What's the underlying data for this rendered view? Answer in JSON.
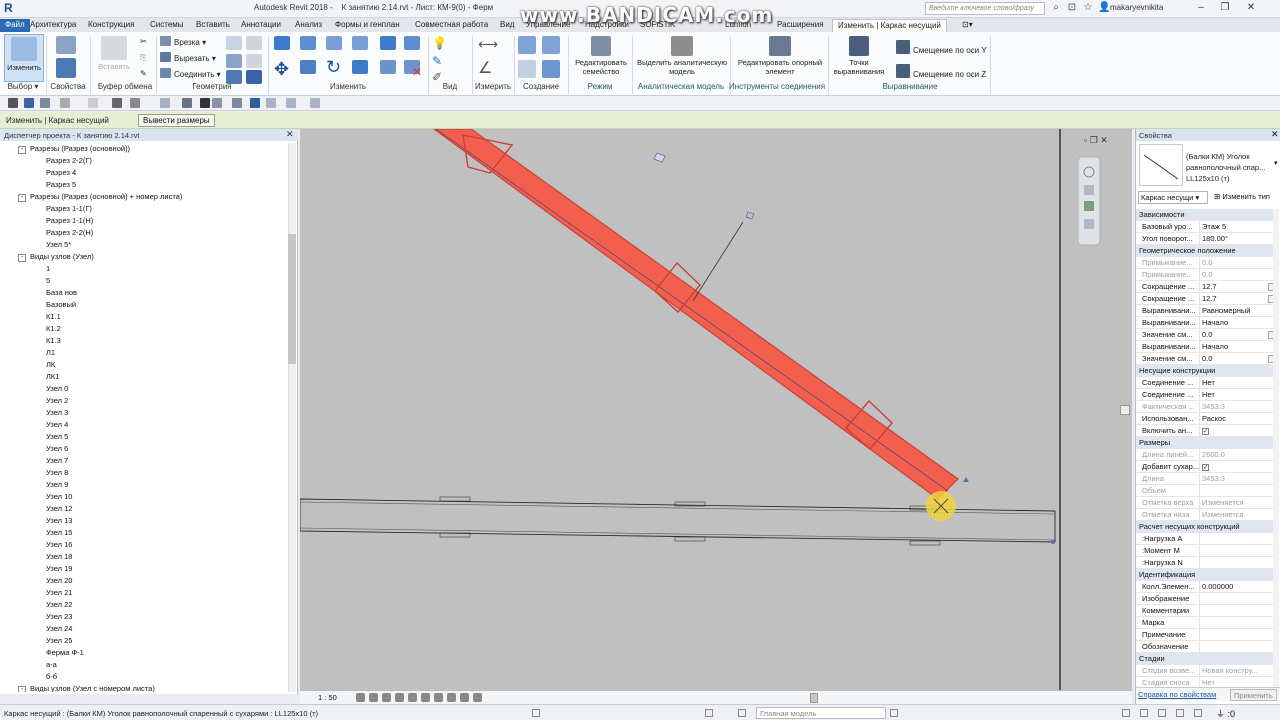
{
  "titlebar": {
    "app_title": "Autodesk Revit 2018 -",
    "file_title": "К занятию 2.14.rvt - Лист: КМ-9(0) - Ферм",
    "search_placeholder": "Введите ключевое слово/фразу",
    "user": "makaryevnikita",
    "watermark": "www.BANDICAM.com"
  },
  "tabs": {
    "file": "Файл",
    "items": [
      "Архитектура",
      "Конструкция",
      "Системы",
      "Вставить",
      "Аннотации",
      "Анализ",
      "Формы и генплан",
      "Совместная работа",
      "Вид",
      "Управление",
      "Надстройки",
      "SOFiSTiK",
      "Lumion",
      "Расширения"
    ],
    "active": "Изменить | Каркас несущий"
  },
  "ribbon": {
    "modify_label": "Изменить",
    "paste_label": "Вставить",
    "cut_label": "Врезка",
    "cut2_label": "Вырезать",
    "join_label": "Соединить",
    "edit_family_label": "Редактировать семейство",
    "highlight_label": "Выделить аналитическую модель",
    "edit_ref_label": "Редактировать опорный элемент",
    "points_label": "Точки выравнивания",
    "offset_y": "Смещение по оси Y",
    "offset_z": "Смещение по оси Z",
    "groups": [
      "Выбор",
      "Свойства",
      "Буфер обмена",
      "Геометрия",
      "Изменить",
      "Вид",
      "Измерить",
      "Создание",
      "Режим",
      "Аналитическая модель",
      "Инструменты соединения",
      "Выравнивание"
    ]
  },
  "optionsbar": {
    "context": "Изменить | Каркас несущий",
    "button": "Вывести размеры"
  },
  "browser": {
    "title": "Диспетчер проекта - К занятию 2.14.rvt",
    "items": [
      {
        "level": 1,
        "toggle": "-",
        "text": "Разрезы (Разрез (основной))"
      },
      {
        "level": 2,
        "text": "Разрез 2-2(Г)"
      },
      {
        "level": 2,
        "text": "Разрез 4"
      },
      {
        "level": 2,
        "text": "Разрез 5"
      },
      {
        "level": 1,
        "toggle": "-",
        "text": "Разрезы (Разрез (основной) + номер листа)"
      },
      {
        "level": 2,
        "text": "Разрез 1-1(Г)"
      },
      {
        "level": 2,
        "text": "Разрез 1-1(Н)"
      },
      {
        "level": 2,
        "text": "Разрез 2-2(Н)"
      },
      {
        "level": 2,
        "text": "Узел 5*"
      },
      {
        "level": 1,
        "toggle": "-",
        "text": "Виды узлов (Узел)"
      },
      {
        "level": 2,
        "text": "1"
      },
      {
        "level": 2,
        "text": "5"
      },
      {
        "level": 2,
        "text": "База нов"
      },
      {
        "level": 2,
        "text": "Базовый"
      },
      {
        "level": 2,
        "text": "К1.1"
      },
      {
        "level": 2,
        "text": "К1.2"
      },
      {
        "level": 2,
        "text": "К1.3"
      },
      {
        "level": 2,
        "text": "Л1"
      },
      {
        "level": 2,
        "text": "ЛК"
      },
      {
        "level": 2,
        "text": "ЛК1"
      },
      {
        "level": 2,
        "text": "Узел 0"
      },
      {
        "level": 2,
        "text": "Узел 2"
      },
      {
        "level": 2,
        "text": "Узел 3"
      },
      {
        "level": 2,
        "text": "Узел 4"
      },
      {
        "level": 2,
        "text": "Узел 5"
      },
      {
        "level": 2,
        "text": "Узел 6"
      },
      {
        "level": 2,
        "text": "Узел 7"
      },
      {
        "level": 2,
        "text": "Узел 8"
      },
      {
        "level": 2,
        "text": "Узел 9"
      },
      {
        "level": 2,
        "text": "Узел 10"
      },
      {
        "level": 2,
        "text": "Узел 12"
      },
      {
        "level": 2,
        "text": "Узел 13"
      },
      {
        "level": 2,
        "text": "Узел 15"
      },
      {
        "level": 2,
        "text": "Узел 16"
      },
      {
        "level": 2,
        "text": "Узел 18"
      },
      {
        "level": 2,
        "text": "Узел 19"
      },
      {
        "level": 2,
        "text": "Узел 20"
      },
      {
        "level": 2,
        "text": "Узел 21"
      },
      {
        "level": 2,
        "text": "Узел 22"
      },
      {
        "level": 2,
        "text": "Узел 23"
      },
      {
        "level": 2,
        "text": "Узел 24"
      },
      {
        "level": 2,
        "text": "Узел 25"
      },
      {
        "level": 2,
        "text": "Ферма Ф-1"
      },
      {
        "level": 2,
        "text": "а-а"
      },
      {
        "level": 2,
        "text": "б-б"
      },
      {
        "level": 1,
        "toggle": "-",
        "text": "Виды узлов (Узел с номером листа)"
      }
    ]
  },
  "canvas": {
    "scale": "1 : 50"
  },
  "properties": {
    "title": "Свойства",
    "type_name": "(Балки КМ) Уголок равнополочный спар... LL125x10 (т)",
    "type_dropdown": "Каркас несущи",
    "edit_type": "Изменить тип",
    "sections": [
      {
        "name": "Зависимости",
        "rows": [
          {
            "k": "Базовый уро...",
            "v": "Этаж 5"
          },
          {
            "k": "Угол поворот...",
            "v": "180.00°"
          }
        ]
      },
      {
        "name": "Геометрическое положение",
        "rows": [
          {
            "k": "Примыкание...",
            "v": "0.0",
            "dim": true
          },
          {
            "k": "Примыкание...",
            "v": "0.0",
            "dim": true
          },
          {
            "k": "Сокращение ...",
            "v": "12.7",
            "mini": true
          },
          {
            "k": "Сокращение ...",
            "v": "12.7",
            "mini": true
          },
          {
            "k": "Выравнивани...",
            "v": "Равномерный"
          },
          {
            "k": "Выравнивани...",
            "v": "Начало"
          },
          {
            "k": "Значение см...",
            "v": "0.0",
            "mini": true
          },
          {
            "k": "Выравнивани...",
            "v": "Начало"
          },
          {
            "k": "Значение см...",
            "v": "0.0",
            "mini": true
          }
        ]
      },
      {
        "name": "Несущие конструкции",
        "rows": [
          {
            "k": "Соединение ...",
            "v": "Нет"
          },
          {
            "k": "Соединение ...",
            "v": "Нет"
          },
          {
            "k": "Фактическая ...",
            "v": "3453.3",
            "dim": true
          },
          {
            "k": "Использован...",
            "v": "Раскос"
          },
          {
            "k": "Включить ан...",
            "v": "✓",
            "check": true
          }
        ]
      },
      {
        "name": "Размеры",
        "rows": [
          {
            "k": "Длина линей...",
            "v": "2600.0",
            "dim": true
          },
          {
            "k": "Добавит сухар...",
            "v": "✓",
            "check": true
          },
          {
            "k": "Длина",
            "v": "3453.3",
            "dim": true
          },
          {
            "k": "Объем",
            "v": "",
            "dim": true
          },
          {
            "k": "Отметка верха",
            "v": "Изменяется",
            "dim": true
          },
          {
            "k": "Отметка низа",
            "v": "Изменяется",
            "dim": true
          }
        ]
      },
      {
        "name": "Расчет несущих конструкций",
        "rows": [
          {
            "k": ":Нагрузка A",
            "v": ""
          },
          {
            "k": ":Момент M",
            "v": ""
          },
          {
            "k": ":Нагрузка N",
            "v": ""
          }
        ]
      },
      {
        "name": "Идентификация",
        "rows": [
          {
            "k": "Колл.Элемен...",
            "v": "0.000000"
          },
          {
            "k": "Изображение",
            "v": ""
          },
          {
            "k": "Комментарии",
            "v": ""
          },
          {
            "k": "Марка",
            "v": ""
          },
          {
            "k": "Примечание",
            "v": ""
          },
          {
            "k": "Обозначение",
            "v": ""
          }
        ]
      },
      {
        "name": "Стадии",
        "rows": [
          {
            "k": "Стадия возве...",
            "v": "Новая констру...",
            "dim": true
          },
          {
            "k": "Стадия сноса",
            "v": "Нет",
            "dim": true
          }
        ]
      }
    ],
    "help_link": "Справка по свойствам",
    "apply": "Применить"
  },
  "status": {
    "text": "Каркас несущий : (Балки КМ) Уголок равнополочный спаренный с сухарями : LL125x10 (т)",
    "model": "Главная модель"
  },
  "colors": {
    "beam_fill": "#f25f4c",
    "beam_stroke": "#c8413a",
    "highlight": "#f2d23a",
    "canvas_bg": "#c0c0c0"
  }
}
